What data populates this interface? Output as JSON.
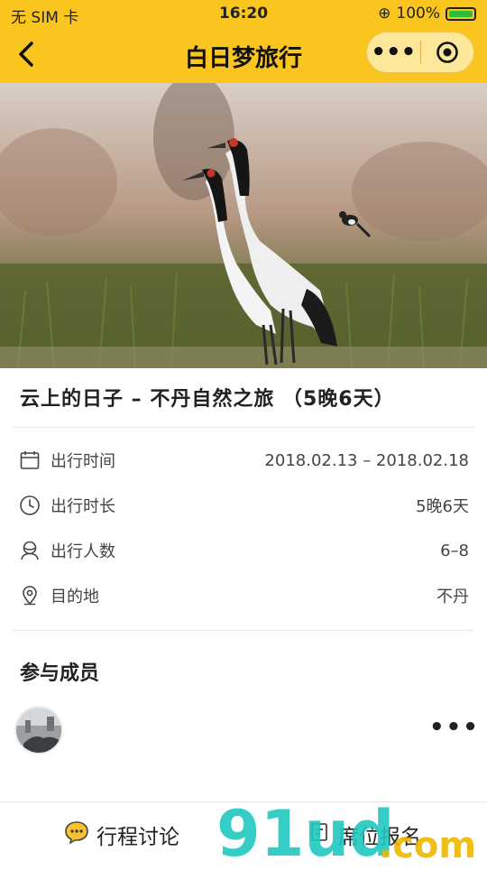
{
  "status_bar": {
    "carrier": "无 SIM 卡",
    "time": "16:20",
    "battery": "100%"
  },
  "nav": {
    "back_icon": "chevron-left-icon",
    "title": "白日梦旅行",
    "more_icon": "ellipsis-icon",
    "close_icon": "target-icon"
  },
  "trip": {
    "title": "云上的日子 – 不丹自然之旅 （5晚6天）",
    "details": [
      {
        "icon": "calendar-icon",
        "label": "出行时间",
        "value": "2018.02.13 – 2018.02.18"
      },
      {
        "icon": "clock-icon",
        "label": "出行时长",
        "value": "5晚6天"
      },
      {
        "icon": "people-icon",
        "label": "出行人数",
        "value": "6–8"
      },
      {
        "icon": "location-pin-icon",
        "label": "目的地",
        "value": "不丹"
      }
    ]
  },
  "members": {
    "title": "参与成员",
    "more_icon": "ellipsis-icon"
  },
  "bottom_bar": {
    "discuss_label": "行程讨论",
    "signup_label": "席位报名"
  },
  "watermark": {
    "text": "91ud.com"
  },
  "colors": {
    "brand_yellow": "#f9c51e",
    "watermark_teal": "#20c8c0",
    "watermark_yellow": "#f0b800"
  }
}
